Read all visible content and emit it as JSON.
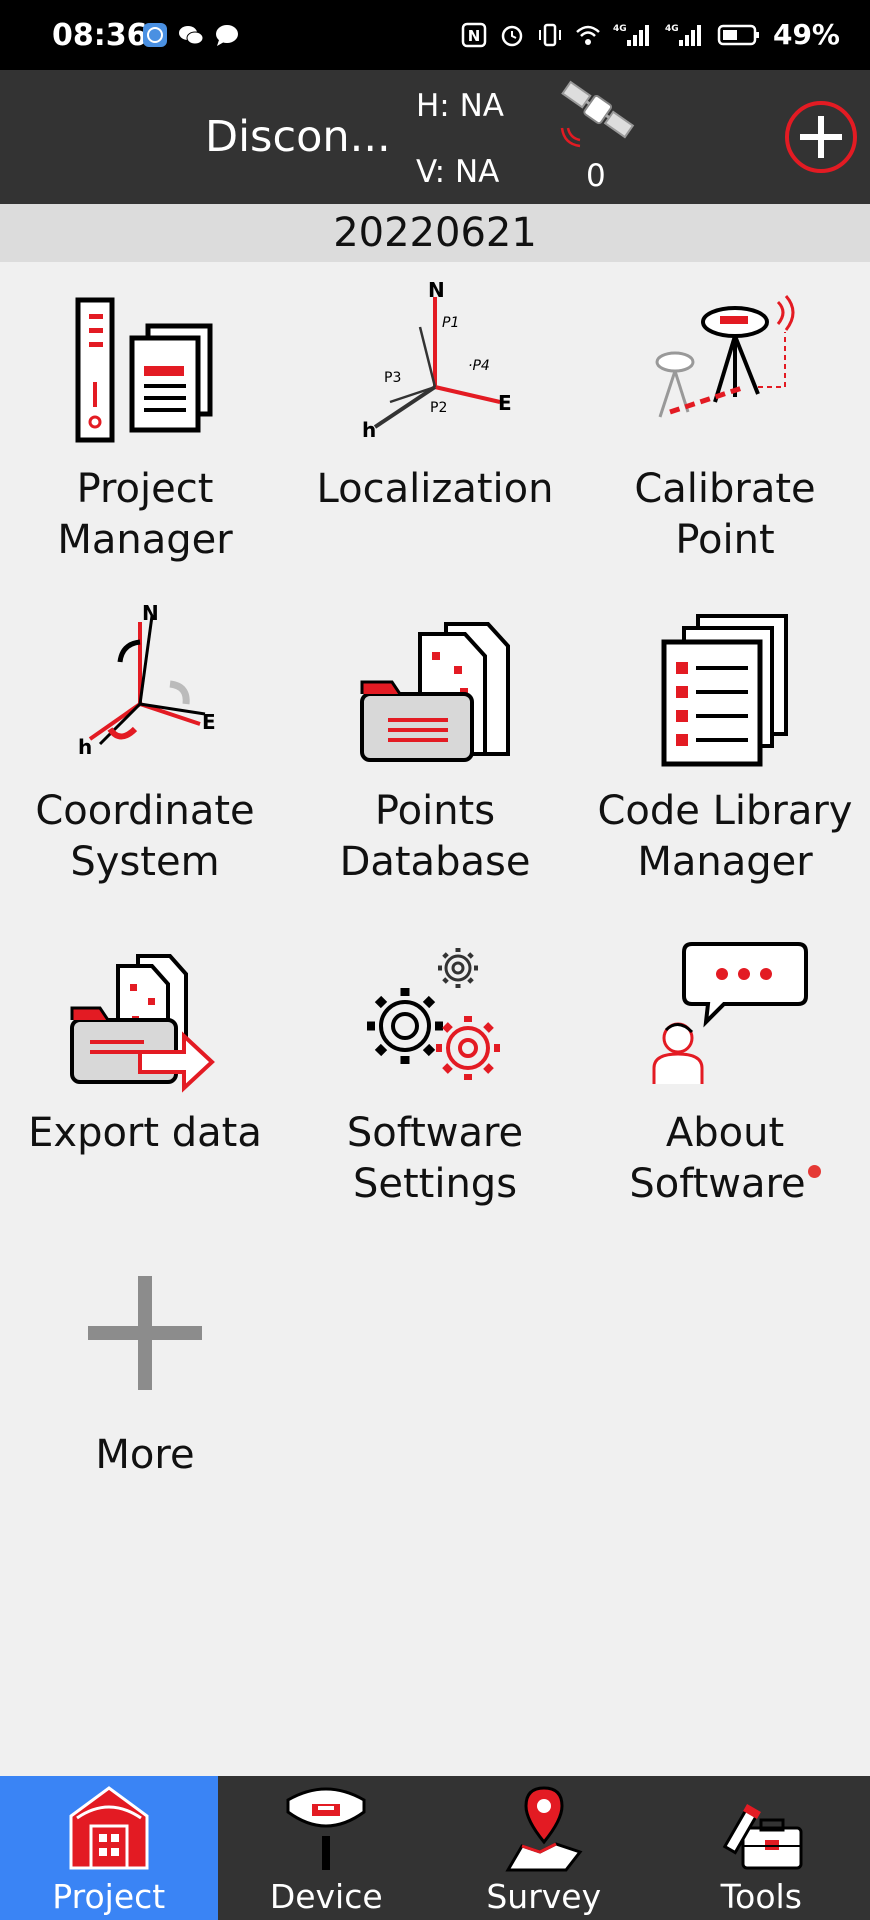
{
  "status_bar": {
    "time": "08:36",
    "battery": "49%",
    "icons": [
      "browser-icon",
      "wechat-icon",
      "chat-bubble-icon",
      "nfc-icon",
      "alarm-icon",
      "vibrate-icon",
      "wifi-icon",
      "signal-4g-icon",
      "signal-4g-icon",
      "battery-icon"
    ]
  },
  "header": {
    "connection": "Discon...",
    "h": "H: NA",
    "v": "V: NA",
    "satellites": "0"
  },
  "date": "20220621",
  "grid": [
    {
      "label": "Project Manager",
      "icon": "project-manager-icon"
    },
    {
      "label": "Localization",
      "icon": "localization-icon"
    },
    {
      "label": "Calibrate Point",
      "icon": "calibrate-point-icon"
    },
    {
      "label": "Coordinate System",
      "icon": "coordinate-system-icon"
    },
    {
      "label": "Points Database",
      "icon": "points-database-icon"
    },
    {
      "label": "Code Library Manager",
      "icon": "code-library-icon"
    },
    {
      "label": "Export data",
      "icon": "export-data-icon"
    },
    {
      "label": "Software Settings",
      "icon": "gears-icon"
    },
    {
      "label": "About Software",
      "icon": "about-software-icon"
    },
    {
      "label": "More",
      "icon": "plus-icon"
    }
  ],
  "nav": [
    {
      "label": "Project",
      "icon": "project-building-icon",
      "active": true
    },
    {
      "label": "Device",
      "icon": "gnss-receiver-icon",
      "active": false
    },
    {
      "label": "Survey",
      "icon": "map-pin-icon",
      "active": false
    },
    {
      "label": "Tools",
      "icon": "toolbox-icon",
      "active": false
    }
  ],
  "colors": {
    "accent_red": "#e31b23",
    "nav_active": "#3a84f5",
    "header_bg": "#333333"
  }
}
